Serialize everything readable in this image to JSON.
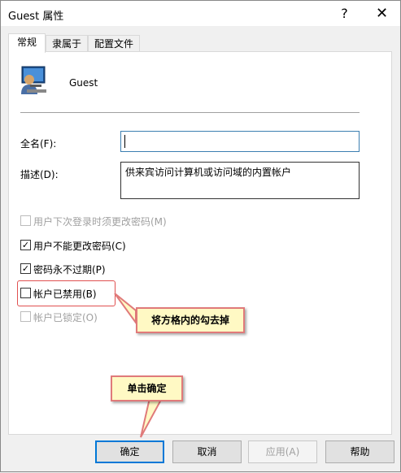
{
  "window": {
    "title": "Guest 属性",
    "help_glyph": "?",
    "close_glyph": "✕"
  },
  "tabs": [
    {
      "label": "常规"
    },
    {
      "label": "隶属于"
    },
    {
      "label": "配置文件"
    }
  ],
  "user": {
    "name": "Guest"
  },
  "fields": {
    "fullname_label": "全名(F):",
    "fullname_value": "",
    "description_label": "描述(D):",
    "description_value": "供来宾访问计算机或访问域的内置帐户"
  },
  "checkboxes": [
    {
      "label": "用户下次登录时须更改密码(M)",
      "checked": false,
      "enabled": false
    },
    {
      "label": "用户不能更改密码(C)",
      "checked": true,
      "enabled": true
    },
    {
      "label": "密码永不过期(P)",
      "checked": true,
      "enabled": true
    },
    {
      "label": "帐户已禁用(B)",
      "checked": false,
      "enabled": true
    },
    {
      "label": "帐户已锁定(O)",
      "checked": false,
      "enabled": false
    }
  ],
  "annotations": {
    "uncheck_note": "将方格内的勾去掉",
    "click_note": "单击确定"
  },
  "buttons": {
    "ok": "确定",
    "cancel": "取消",
    "apply": "应用(A)",
    "help": "帮助"
  }
}
